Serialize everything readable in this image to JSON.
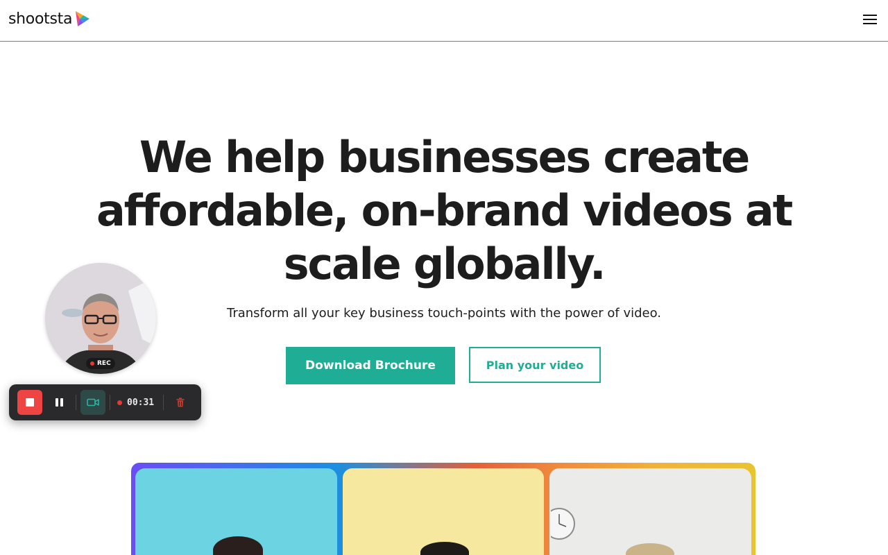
{
  "header": {
    "logo_text": "shootsta",
    "logo_icon": "shootsta-logo-icon",
    "menu_icon": "hamburger-menu-icon"
  },
  "hero": {
    "title": "We help businesses create affordable, on-brand videos at scale globally.",
    "subtitle": "Transform all your key business touch-points with the power of video.",
    "primary_button": "Download Brochure",
    "secondary_button": "Plan your video"
  },
  "webcam": {
    "badge": "REC"
  },
  "recorder": {
    "stop_icon": "stop-icon",
    "pause_icon": "pause-icon",
    "camera_icon": "video-camera-icon",
    "timer": "00:31",
    "delete_icon": "trash-icon"
  },
  "colors": {
    "brand_teal": "#20ad95",
    "header_border": "#1fa7a0",
    "record_red": "#ef4444",
    "toolbar_bg": "#2a2a2c"
  }
}
